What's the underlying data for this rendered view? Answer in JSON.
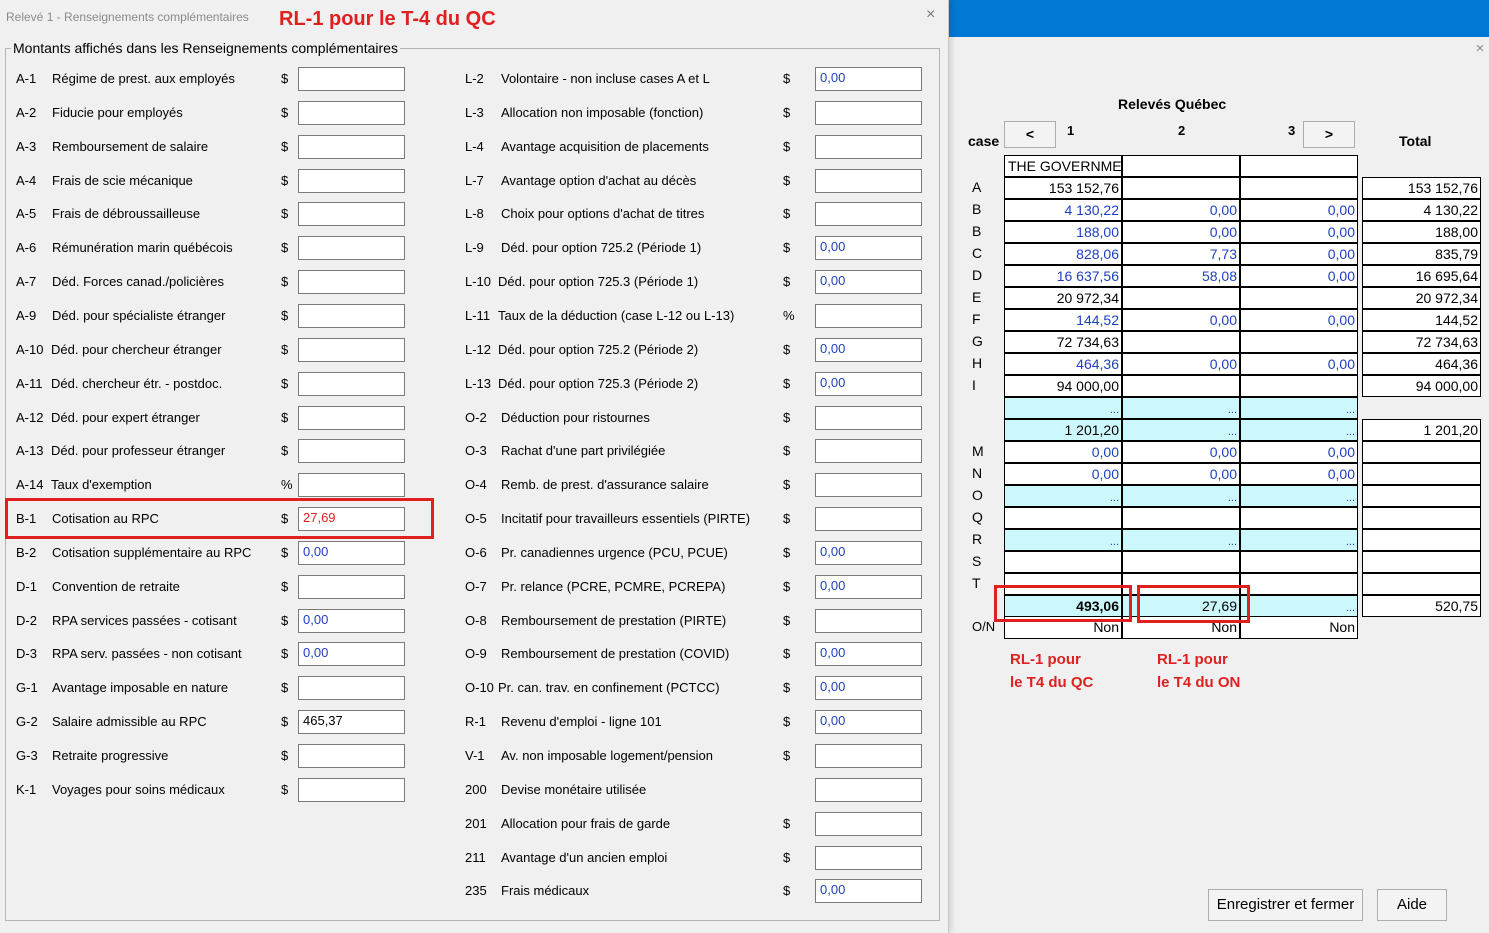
{
  "dialog": {
    "title": "Relevé 1 - Renseignements complémentaires",
    "annotation": "RL-1 pour le T-4 du QC",
    "close_glyph": "×",
    "group_title": "Montants affichés dans les Renseignements complémentaires",
    "left_fields": [
      {
        "code": "A-1",
        "label": "Régime de prest. aux employés",
        "unit": "$",
        "value": ""
      },
      {
        "code": "A-2",
        "label": "Fiducie pour employés",
        "unit": "$",
        "value": ""
      },
      {
        "code": "A-3",
        "label": "Remboursement de salaire",
        "unit": "$",
        "value": ""
      },
      {
        "code": "A-4",
        "label": "Frais de scie mécanique",
        "unit": "$",
        "value": ""
      },
      {
        "code": "A-5",
        "label": "Frais de débroussailleuse",
        "unit": "$",
        "value": ""
      },
      {
        "code": "A-6",
        "label": "Rémunération marin québécois",
        "unit": "$",
        "value": ""
      },
      {
        "code": "A-7",
        "label": "Déd. Forces canad./policières",
        "unit": "$",
        "value": ""
      },
      {
        "code": "A-9",
        "label": "Déd. pour spécialiste étranger",
        "unit": "$",
        "value": ""
      },
      {
        "code": "A-10",
        "label": "Déd. pour chercheur étranger",
        "unit": "$",
        "value": ""
      },
      {
        "code": "A-11",
        "label": "Déd. chercheur étr. - postdoc.",
        "unit": "$",
        "value": ""
      },
      {
        "code": "A-12",
        "label": "Déd. pour expert étranger",
        "unit": "$",
        "value": ""
      },
      {
        "code": "A-13",
        "label": "Déd. pour professeur étranger",
        "unit": "$",
        "value": ""
      },
      {
        "code": "A-14",
        "label": "Taux d'exemption",
        "unit": "%",
        "value": ""
      },
      {
        "code": "B-1",
        "label": "Cotisation au RPC",
        "unit": "$",
        "value": "27,69"
      },
      {
        "code": "B-2",
        "label": "Cotisation supplémentaire au RPC",
        "unit": "$",
        "value": "0,00"
      },
      {
        "code": "D-1",
        "label": "Convention de retraite",
        "unit": "$",
        "value": ""
      },
      {
        "code": "D-2",
        "label": "RPA services passées - cotisant",
        "unit": "$",
        "value": "0,00"
      },
      {
        "code": "D-3",
        "label": "RPA serv. passées - non cotisant",
        "unit": "$",
        "value": "0,00"
      },
      {
        "code": "G-1",
        "label": "Avantage imposable en nature",
        "unit": "$",
        "value": ""
      },
      {
        "code": "G-2",
        "label": "Salaire admissible au RPC",
        "unit": "$",
        "value": "465,37"
      },
      {
        "code": "G-3",
        "label": "Retraite progressive",
        "unit": "$",
        "value": ""
      },
      {
        "code": "K-1",
        "label": "Voyages pour soins médicaux",
        "unit": "$",
        "value": ""
      }
    ],
    "right_fields": [
      {
        "code": "L-2",
        "label": "Volontaire - non incluse cases A et L",
        "unit": "$",
        "value": "0,00"
      },
      {
        "code": "L-3",
        "label": "Allocation non imposable (fonction)",
        "unit": "$",
        "value": ""
      },
      {
        "code": "L-4",
        "label": "Avantage acquisition de placements",
        "unit": "$",
        "value": ""
      },
      {
        "code": "L-7",
        "label": "Avantage option d'achat au décès",
        "unit": "$",
        "value": ""
      },
      {
        "code": "L-8",
        "label": "Choix pour options d'achat de titres",
        "unit": "$",
        "value": ""
      },
      {
        "code": "L-9",
        "label": "Déd. pour option 725.2 (Période 1)",
        "unit": "$",
        "value": "0,00"
      },
      {
        "code": "L-10",
        "label": "Déd. pour option 725.3 (Période 1)",
        "unit": "$",
        "value": "0,00"
      },
      {
        "code": "L-11",
        "label": "Taux de la déduction (case L-12 ou L-13)",
        "unit": "%",
        "value": ""
      },
      {
        "code": "L-12",
        "label": "Déd. pour option 725.2 (Période 2)",
        "unit": "$",
        "value": "0,00"
      },
      {
        "code": "L-13",
        "label": "Déd. pour option 725.3 (Période 2)",
        "unit": "$",
        "value": "0,00"
      },
      {
        "code": "O-2",
        "label": "Déduction pour ristournes",
        "unit": "$",
        "value": ""
      },
      {
        "code": "O-3",
        "label": "Rachat d'une part privilégiée",
        "unit": "$",
        "value": ""
      },
      {
        "code": "O-4",
        "label": "Remb. de prest. d'assurance salaire",
        "unit": "$",
        "value": ""
      },
      {
        "code": "O-5",
        "label": "Incitatif pour travailleurs essentiels (PIRTE)",
        "unit": "$",
        "value": ""
      },
      {
        "code": "O-6",
        "label": "Pr. canadiennes urgence (PCU, PCUE)",
        "unit": "$",
        "value": "0,00"
      },
      {
        "code": "O-7",
        "label": "Pr. relance (PCRE, PCMRE, PCREPA)",
        "unit": "$",
        "value": "0,00"
      },
      {
        "code": "O-8",
        "label": "Remboursement de prestation (PIRTE)",
        "unit": "$",
        "value": ""
      },
      {
        "code": "O-9",
        "label": "Remboursement de prestation (COVID)",
        "unit": "$",
        "value": "0,00"
      },
      {
        "code": "O-10",
        "label": "Pr. can. trav. en confinement (PCTCC)",
        "unit": "$",
        "value": "0,00"
      },
      {
        "code": "R-1",
        "label": "Revenu d'emploi - ligne 101",
        "unit": "$",
        "value": "0,00"
      },
      {
        "code": "V-1",
        "label": "Av. non imposable logement/pension",
        "unit": "$",
        "value": ""
      },
      {
        "code": "200",
        "label": "Devise monétaire utilisée",
        "unit": "",
        "value": ""
      },
      {
        "code": "201",
        "label": "Allocation pour frais de garde",
        "unit": "$",
        "value": ""
      },
      {
        "code": "211",
        "label": "Avantage d'un ancien emploi",
        "unit": "$",
        "value": ""
      },
      {
        "code": "235",
        "label": "Frais médicaux",
        "unit": "$",
        "value": "0,00"
      }
    ]
  },
  "releves": {
    "title": "Relevés Québec",
    "case_label": "case",
    "prev_label": "<",
    "next_label": ">",
    "col_numbers": [
      "1",
      "2",
      "3"
    ],
    "total_label": "Total",
    "close_glyph": "×",
    "header_row": {
      "c1": "THE GOVERNME",
      "c2": "",
      "c3": ""
    },
    "rows": [
      {
        "label": "A",
        "c1": "153 152,76",
        "c2": "",
        "c3": "",
        "total": "153 152,76",
        "style": "plain-blue23"
      },
      {
        "label": "B",
        "c1": "4 130,22",
        "c2": "0,00",
        "c3": "0,00",
        "total": "4 130,22",
        "style": "blue"
      },
      {
        "label": "B",
        "c1": "188,00",
        "c2": "0,00",
        "c3": "0,00",
        "total": "188,00",
        "style": "blue"
      },
      {
        "label": "C",
        "c1": "828,06",
        "c2": "7,73",
        "c3": "0,00",
        "total": "835,79",
        "style": "blue"
      },
      {
        "label": "D",
        "c1": "16 637,56",
        "c2": "58,08",
        "c3": "0,00",
        "total": "16 695,64",
        "style": "blue"
      },
      {
        "label": "E",
        "c1": "20 972,34",
        "c2": "",
        "c3": "",
        "total": "20 972,34",
        "style": "plain"
      },
      {
        "label": "F",
        "c1": "144,52",
        "c2": "0,00",
        "c3": "0,00",
        "total": "144,52",
        "style": "blue"
      },
      {
        "label": "G",
        "c1": "72 734,63",
        "c2": "",
        "c3": "",
        "total": "72 734,63",
        "style": "plain"
      },
      {
        "label": "H",
        "c1": "464,36",
        "c2": "0,00",
        "c3": "0,00",
        "total": "464,36",
        "style": "blue"
      },
      {
        "label": "I",
        "c1": "94 000,00",
        "c2": "",
        "c3": "",
        "total": "94 000,00",
        "style": "plain"
      },
      {
        "label": "",
        "c1": "...",
        "c2": "...",
        "c3": "...",
        "total": null,
        "style": "cyan-dots"
      },
      {
        "label": "",
        "c1": "1 201,20",
        "c2": "...",
        "c3": "...",
        "total": "1 201,20",
        "style": "cyan-mixed"
      },
      {
        "label": "M",
        "c1": "0,00",
        "c2": "0,00",
        "c3": "0,00",
        "total": "",
        "style": "blue"
      },
      {
        "label": "N",
        "c1": "0,00",
        "c2": "0,00",
        "c3": "0,00",
        "total": "",
        "style": "blue"
      },
      {
        "label": "O",
        "c1": "...",
        "c2": "...",
        "c3": "...",
        "total": "",
        "style": "cyan-dots"
      },
      {
        "label": "Q",
        "c1": "",
        "c2": "",
        "c3": "",
        "total": "",
        "style": "plain"
      },
      {
        "label": "R",
        "c1": "...",
        "c2": "...",
        "c3": "...",
        "total": "",
        "style": "cyan-dots"
      },
      {
        "label": "S",
        "c1": "",
        "c2": "",
        "c3": "",
        "total": "",
        "style": "plain"
      },
      {
        "label": "T",
        "c1": "",
        "c2": "",
        "c3": "",
        "total": "",
        "style": "plain"
      },
      {
        "label": "",
        "c1": "493,06",
        "c2": "27,69",
        "c3": "...",
        "total": "520,75",
        "style": "cyan-sum"
      },
      {
        "label": "O/N",
        "c1": "Non",
        "c2": "Non",
        "c3": "Non",
        "total": null,
        "style": "on"
      }
    ],
    "note_qc": [
      "RL-1 pour",
      "le T4 du QC"
    ],
    "note_on": [
      "RL-1 pour",
      "le T4 du ON"
    ],
    "save_label": "Enregistrer et fermer",
    "help_label": "Aide"
  },
  "colors": {
    "accent_blue": "#0078d4",
    "value_blue": "#1f3fc0",
    "annotation_red": "#e02020",
    "cyan_cell": "#ccf8fc"
  }
}
